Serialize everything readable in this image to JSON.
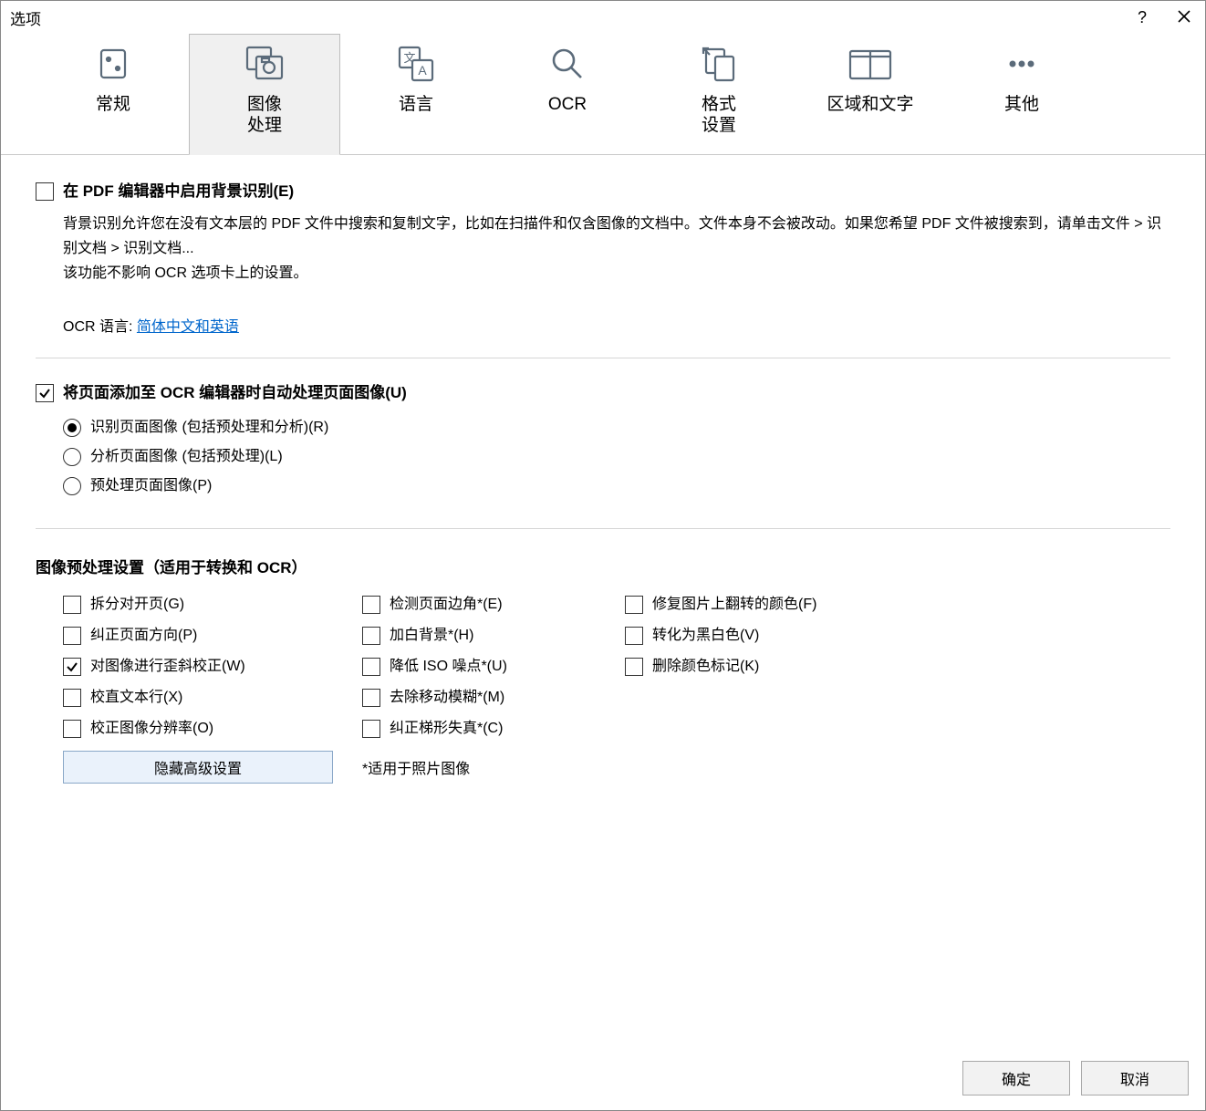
{
  "window": {
    "title": "选项"
  },
  "tabs": [
    {
      "label": "常规"
    },
    {
      "label": "图像\n处理"
    },
    {
      "label": "语言"
    },
    {
      "label": "OCR"
    },
    {
      "label": "格式\n设置"
    },
    {
      "label": "区域和文字"
    },
    {
      "label": "其他"
    }
  ],
  "section1": {
    "checkbox_label": "在 PDF 编辑器中启用背景识别(E)",
    "desc_line1": "背景识别允许您在没有文本层的 PDF 文件中搜索和复制文字，比如在扫描件和仅含图像的文档中。文件本身不会被改动。如果您希望 PDF 文件被搜索到，请单击文件 > 识别文档 > 识别文档...",
    "desc_line2": "该功能不影响 OCR 选项卡上的设置。",
    "ocr_label": "OCR 语言: ",
    "ocr_link": "简体中文和英语"
  },
  "section2": {
    "checkbox_label": "将页面添加至 OCR 编辑器时自动处理页面图像(U)",
    "radio1": "识别页面图像 (包括预处理和分析)(R)",
    "radio2": "分析页面图像 (包括预处理)(L)",
    "radio3": "预处理页面图像(P)"
  },
  "section3": {
    "heading": "图像预处理设置（适用于转换和 OCR）",
    "col1": [
      "拆分对开页(G)",
      "纠正页面方向(P)",
      "对图像进行歪斜校正(W)",
      "校直文本行(X)",
      "校正图像分辨率(O)"
    ],
    "col2": [
      "检测页面边角*(E)",
      "加白背景*(H)",
      "降低 ISO 噪点*(U)",
      "去除移动模糊*(M)",
      "纠正梯形失真*(C)"
    ],
    "col3": [
      "修复图片上翻转的颜色(F)",
      "转化为黑白色(V)",
      "删除颜色标记(K)"
    ],
    "hide_button": "隐藏高级设置",
    "note": "*适用于照片图像"
  },
  "footer": {
    "ok": "确定",
    "cancel": "取消"
  }
}
